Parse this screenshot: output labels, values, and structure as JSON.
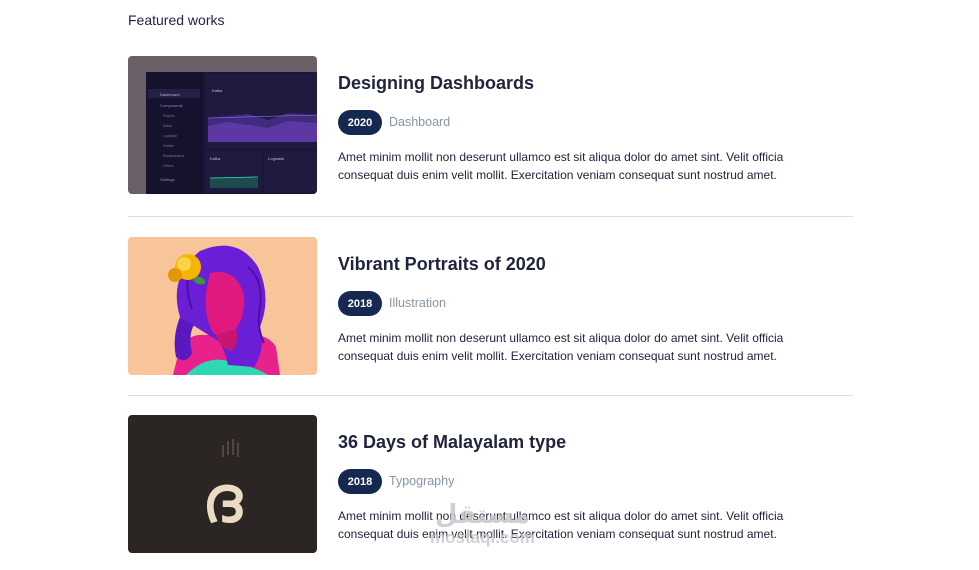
{
  "section": {
    "title": "Featured works"
  },
  "works": [
    {
      "title": "Designing Dashboards",
      "year": "2020",
      "category": "Dashboard",
      "description": "Amet minim mollit non deserunt ullamco est sit aliqua dolor do amet sint. Velit officia consequat duis enim velit mollit. Exercitation veniam consequat sunt nostrud amet.",
      "thumbnail": {
        "sidebar_items": [
          "Dashboard",
          "Components",
          "Players",
          "Kafka",
          "Logstash",
          "Grafter",
          "Elasticsearch",
          "Others",
          "Settings"
        ],
        "header_label": "Kafka",
        "panel_labels": [
          "Kafka",
          "Logstash"
        ]
      }
    },
    {
      "title": "Vibrant Portraits of 2020",
      "year": "2018",
      "category": "Illustration",
      "description": "Amet minim mollit non deserunt ullamco est sit aliqua dolor do amet sint. Velit officia consequat duis enim velit mollit. Exercitation veniam consequat sunt nostrud amet."
    },
    {
      "title": "36 Days of Malayalam type",
      "year": "2018",
      "category": "Typography",
      "description": "Amet minim mollit non deserunt ullamco est sit aliqua dolor do amet sint. Velit officia consequat duis enim velit mollit. Exercitation veniam consequat sunt nostrud amet.",
      "thumbnail": {
        "glyph": "ദ"
      }
    }
  ],
  "watermark": {
    "logo": "مستقل",
    "site": "mostaql.com"
  },
  "colors": {
    "badge_bg": "#142850",
    "text": "#21243d",
    "muted": "#8695a4",
    "divider": "#e0e0e0"
  }
}
